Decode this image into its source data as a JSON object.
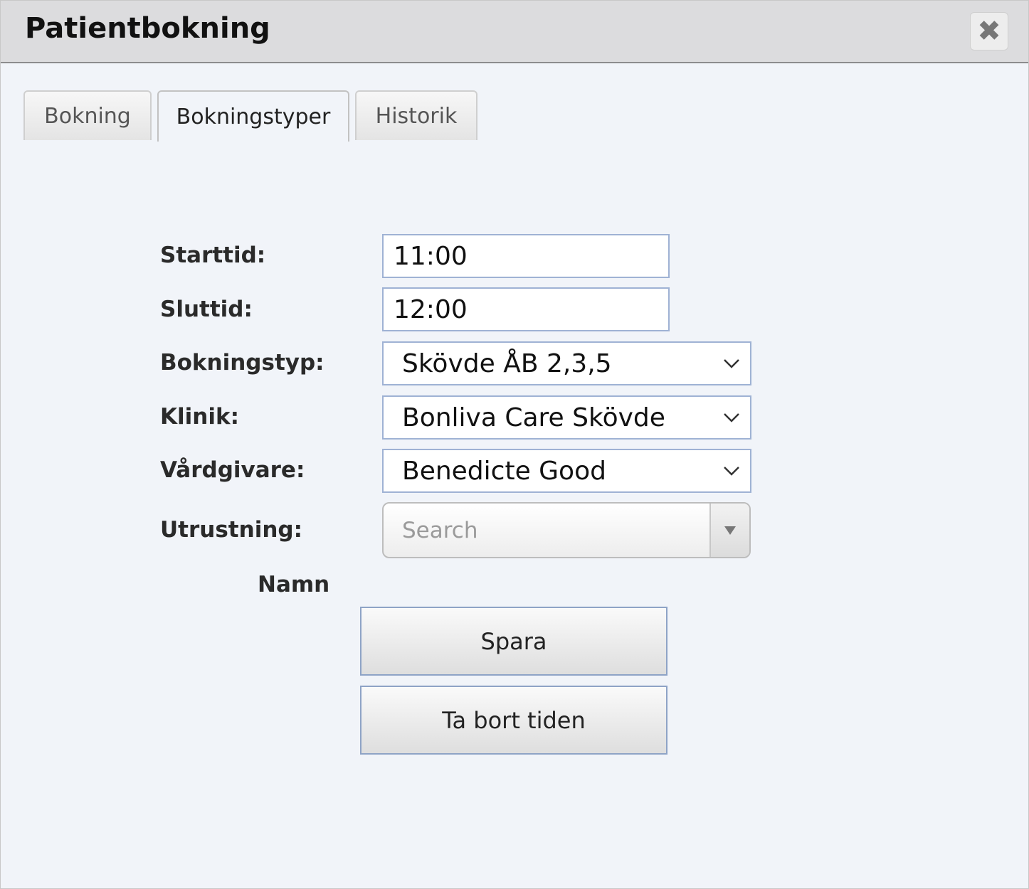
{
  "dialog": {
    "title": "Patientbokning",
    "close_glyph": "✖",
    "close_icon": "close-icon"
  },
  "tabs": [
    {
      "label": "Bokning",
      "active": false
    },
    {
      "label": "Bokningstyper",
      "active": true
    },
    {
      "label": "Historik",
      "active": false
    }
  ],
  "form": {
    "starttid": {
      "label": "Starttid:",
      "value": "11:00"
    },
    "sluttid": {
      "label": "Sluttid:",
      "value": "12:00"
    },
    "bokningstyp": {
      "label": "Bokningstyp:",
      "value": "Skövde ÅB 2,3,5"
    },
    "klinik": {
      "label": "Klinik:",
      "value": "Bonliva Care Skövde"
    },
    "vardgivare": {
      "label": "Vårdgivare:",
      "value": "Benedicte Good"
    },
    "utrustning": {
      "label": "Utrustning:",
      "placeholder": "Search"
    },
    "namn_label": "Namn"
  },
  "actions": {
    "save_label": "Spara",
    "delete_label": "Ta bort tiden"
  },
  "colors": {
    "titlebar": "#dcdcde",
    "body": "#f1f4f9",
    "field_border": "#9fb2d4"
  }
}
